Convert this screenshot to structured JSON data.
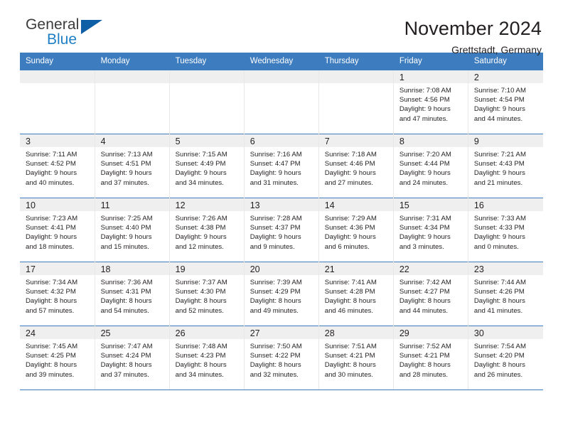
{
  "brand": {
    "name_part1": "General",
    "name_part2": "Blue",
    "triangle_color": "#0e5fa6",
    "blue_color": "#1f7fc4"
  },
  "header": {
    "title": "November 2024",
    "location": "Grettstadt, Germany",
    "accent_color": "#3c7cbf"
  },
  "weekday_headers": [
    "Sunday",
    "Monday",
    "Tuesday",
    "Wednesday",
    "Thursday",
    "Friday",
    "Saturday"
  ],
  "labels": {
    "sunrise_prefix": "Sunrise:",
    "sunset_prefix": "Sunset:",
    "daylight_prefix": "Daylight:"
  },
  "weeks": [
    [
      {
        "day": "",
        "empty": true
      },
      {
        "day": "",
        "empty": true
      },
      {
        "day": "",
        "empty": true
      },
      {
        "day": "",
        "empty": true
      },
      {
        "day": "",
        "empty": true
      },
      {
        "day": "1",
        "sunrise": "Sunrise: 7:08 AM",
        "sunset": "Sunset: 4:56 PM",
        "daylight_line1": "Daylight: 9 hours",
        "daylight_line2": "and 47 minutes."
      },
      {
        "day": "2",
        "sunrise": "Sunrise: 7:10 AM",
        "sunset": "Sunset: 4:54 PM",
        "daylight_line1": "Daylight: 9 hours",
        "daylight_line2": "and 44 minutes."
      }
    ],
    [
      {
        "day": "3",
        "sunrise": "Sunrise: 7:11 AM",
        "sunset": "Sunset: 4:52 PM",
        "daylight_line1": "Daylight: 9 hours",
        "daylight_line2": "and 40 minutes."
      },
      {
        "day": "4",
        "sunrise": "Sunrise: 7:13 AM",
        "sunset": "Sunset: 4:51 PM",
        "daylight_line1": "Daylight: 9 hours",
        "daylight_line2": "and 37 minutes."
      },
      {
        "day": "5",
        "sunrise": "Sunrise: 7:15 AM",
        "sunset": "Sunset: 4:49 PM",
        "daylight_line1": "Daylight: 9 hours",
        "daylight_line2": "and 34 minutes."
      },
      {
        "day": "6",
        "sunrise": "Sunrise: 7:16 AM",
        "sunset": "Sunset: 4:47 PM",
        "daylight_line1": "Daylight: 9 hours",
        "daylight_line2": "and 31 minutes."
      },
      {
        "day": "7",
        "sunrise": "Sunrise: 7:18 AM",
        "sunset": "Sunset: 4:46 PM",
        "daylight_line1": "Daylight: 9 hours",
        "daylight_line2": "and 27 minutes."
      },
      {
        "day": "8",
        "sunrise": "Sunrise: 7:20 AM",
        "sunset": "Sunset: 4:44 PM",
        "daylight_line1": "Daylight: 9 hours",
        "daylight_line2": "and 24 minutes."
      },
      {
        "day": "9",
        "sunrise": "Sunrise: 7:21 AM",
        "sunset": "Sunset: 4:43 PM",
        "daylight_line1": "Daylight: 9 hours",
        "daylight_line2": "and 21 minutes."
      }
    ],
    [
      {
        "day": "10",
        "sunrise": "Sunrise: 7:23 AM",
        "sunset": "Sunset: 4:41 PM",
        "daylight_line1": "Daylight: 9 hours",
        "daylight_line2": "and 18 minutes."
      },
      {
        "day": "11",
        "sunrise": "Sunrise: 7:25 AM",
        "sunset": "Sunset: 4:40 PM",
        "daylight_line1": "Daylight: 9 hours",
        "daylight_line2": "and 15 minutes."
      },
      {
        "day": "12",
        "sunrise": "Sunrise: 7:26 AM",
        "sunset": "Sunset: 4:38 PM",
        "daylight_line1": "Daylight: 9 hours",
        "daylight_line2": "and 12 minutes."
      },
      {
        "day": "13",
        "sunrise": "Sunrise: 7:28 AM",
        "sunset": "Sunset: 4:37 PM",
        "daylight_line1": "Daylight: 9 hours",
        "daylight_line2": "and 9 minutes."
      },
      {
        "day": "14",
        "sunrise": "Sunrise: 7:29 AM",
        "sunset": "Sunset: 4:36 PM",
        "daylight_line1": "Daylight: 9 hours",
        "daylight_line2": "and 6 minutes."
      },
      {
        "day": "15",
        "sunrise": "Sunrise: 7:31 AM",
        "sunset": "Sunset: 4:34 PM",
        "daylight_line1": "Daylight: 9 hours",
        "daylight_line2": "and 3 minutes."
      },
      {
        "day": "16",
        "sunrise": "Sunrise: 7:33 AM",
        "sunset": "Sunset: 4:33 PM",
        "daylight_line1": "Daylight: 9 hours",
        "daylight_line2": "and 0 minutes."
      }
    ],
    [
      {
        "day": "17",
        "sunrise": "Sunrise: 7:34 AM",
        "sunset": "Sunset: 4:32 PM",
        "daylight_line1": "Daylight: 8 hours",
        "daylight_line2": "and 57 minutes."
      },
      {
        "day": "18",
        "sunrise": "Sunrise: 7:36 AM",
        "sunset": "Sunset: 4:31 PM",
        "daylight_line1": "Daylight: 8 hours",
        "daylight_line2": "and 54 minutes."
      },
      {
        "day": "19",
        "sunrise": "Sunrise: 7:37 AM",
        "sunset": "Sunset: 4:30 PM",
        "daylight_line1": "Daylight: 8 hours",
        "daylight_line2": "and 52 minutes."
      },
      {
        "day": "20",
        "sunrise": "Sunrise: 7:39 AM",
        "sunset": "Sunset: 4:29 PM",
        "daylight_line1": "Daylight: 8 hours",
        "daylight_line2": "and 49 minutes."
      },
      {
        "day": "21",
        "sunrise": "Sunrise: 7:41 AM",
        "sunset": "Sunset: 4:28 PM",
        "daylight_line1": "Daylight: 8 hours",
        "daylight_line2": "and 46 minutes."
      },
      {
        "day": "22",
        "sunrise": "Sunrise: 7:42 AM",
        "sunset": "Sunset: 4:27 PM",
        "daylight_line1": "Daylight: 8 hours",
        "daylight_line2": "and 44 minutes."
      },
      {
        "day": "23",
        "sunrise": "Sunrise: 7:44 AM",
        "sunset": "Sunset: 4:26 PM",
        "daylight_line1": "Daylight: 8 hours",
        "daylight_line2": "and 41 minutes."
      }
    ],
    [
      {
        "day": "24",
        "sunrise": "Sunrise: 7:45 AM",
        "sunset": "Sunset: 4:25 PM",
        "daylight_line1": "Daylight: 8 hours",
        "daylight_line2": "and 39 minutes."
      },
      {
        "day": "25",
        "sunrise": "Sunrise: 7:47 AM",
        "sunset": "Sunset: 4:24 PM",
        "daylight_line1": "Daylight: 8 hours",
        "daylight_line2": "and 37 minutes."
      },
      {
        "day": "26",
        "sunrise": "Sunrise: 7:48 AM",
        "sunset": "Sunset: 4:23 PM",
        "daylight_line1": "Daylight: 8 hours",
        "daylight_line2": "and 34 minutes."
      },
      {
        "day": "27",
        "sunrise": "Sunrise: 7:50 AM",
        "sunset": "Sunset: 4:22 PM",
        "daylight_line1": "Daylight: 8 hours",
        "daylight_line2": "and 32 minutes."
      },
      {
        "day": "28",
        "sunrise": "Sunrise: 7:51 AM",
        "sunset": "Sunset: 4:21 PM",
        "daylight_line1": "Daylight: 8 hours",
        "daylight_line2": "and 30 minutes."
      },
      {
        "day": "29",
        "sunrise": "Sunrise: 7:52 AM",
        "sunset": "Sunset: 4:21 PM",
        "daylight_line1": "Daylight: 8 hours",
        "daylight_line2": "and 28 minutes."
      },
      {
        "day": "30",
        "sunrise": "Sunrise: 7:54 AM",
        "sunset": "Sunset: 4:20 PM",
        "daylight_line1": "Daylight: 8 hours",
        "daylight_line2": "and 26 minutes."
      }
    ]
  ]
}
